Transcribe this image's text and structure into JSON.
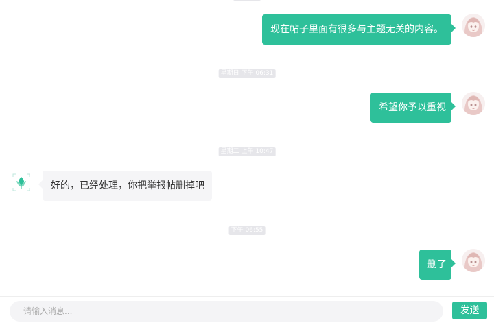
{
  "colors": {
    "accent": "#2ec09a",
    "bubble_in": "#f5f5f7",
    "timestamp_bg": "#e6e6ea"
  },
  "timestamps": [
    {
      "text": "星期日 下午 06:31"
    },
    {
      "text": "星期二 上午 10:47"
    },
    {
      "text": "下午 06:55"
    }
  ],
  "messages": [
    {
      "side": "right",
      "text": "现在帖子里面有很多与主题无关的内容。",
      "avatar": "user-avatar"
    },
    {
      "side": "right",
      "text": "希望你予以重视",
      "avatar": "user-avatar"
    },
    {
      "side": "left",
      "text": "好的，已经处理，你把举报帖删掉吧",
      "avatar": "support-avatar"
    },
    {
      "side": "right",
      "text": "删了",
      "avatar": "user-avatar"
    }
  ],
  "composer": {
    "placeholder": "请输入消息...",
    "send_label": "发送"
  }
}
